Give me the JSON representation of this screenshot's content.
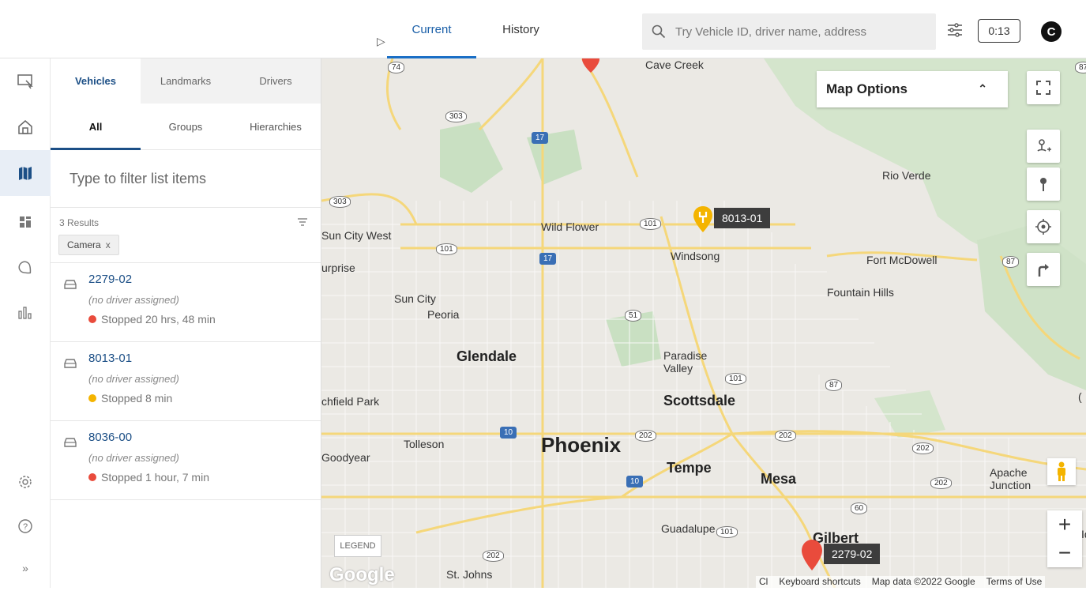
{
  "topbar": {
    "tabs": [
      {
        "label": "Current",
        "active": true
      },
      {
        "label": "History",
        "active": false
      }
    ],
    "search_placeholder": "Try Vehicle ID, driver name, address",
    "timer": "0:13",
    "avatar_initial": "C"
  },
  "leftnav": {
    "items": [
      "live-view-icon",
      "home-icon",
      "map-icon",
      "dashboard-icon",
      "landmark-icon",
      "reports-icon",
      "settings-icon",
      "help-icon",
      "expand-icon"
    ],
    "active": "map-icon",
    "expand_glyph": "»"
  },
  "panel": {
    "entity_tabs": [
      "Vehicles",
      "Landmarks",
      "Drivers"
    ],
    "sub_tabs": [
      "All",
      "Groups",
      "Hierarchies"
    ],
    "filter_placeholder": "Type to filter list items",
    "results_count": "3 Results",
    "chip_label": "Camera",
    "chip_close": "x",
    "vehicles": [
      {
        "id": "2279-02",
        "driver": "(no driver assigned)",
        "status": "Stopped 20 hrs, 48 min",
        "status_color": "#e94b3c"
      },
      {
        "id": "8013-01",
        "driver": "(no driver assigned)",
        "status": "Stopped 8 min",
        "status_color": "#f4b400"
      },
      {
        "id": "8036-00",
        "driver": "(no driver assigned)",
        "status": "Stopped 1 hour, 7 min",
        "status_color": "#e94b3c"
      }
    ]
  },
  "map": {
    "options_label": "Map Options",
    "legend_label": "LEGEND",
    "google_logo": "Google",
    "attribution": [
      "Keyboard shortcuts",
      "Map data ©2022 Google",
      "Terms of Use"
    ],
    "attribution_cut": "Cl",
    "vehicle_labels": {
      "v1": "8013-01",
      "v2": "2279-02"
    },
    "places": {
      "cave_creek": "Cave Creek",
      "rio_verde": "Rio Verde",
      "wild_flower": "Wild Flower",
      "windsong": "Windsong",
      "sun_city_west": "Sun City West",
      "surprise": "urprise",
      "fort_mcdowell": "Fort McDowell",
      "fountain_hills": "Fountain Hills",
      "sun_city": "Sun City",
      "peoria": "Peoria",
      "glendale": "Glendale",
      "paradise_valley": "Paradise\nValley",
      "litchfield_park": "chfield Park",
      "scottsdale": "Scottsdale",
      "tolleson": "Tolleson",
      "phoenix": "Phoenix",
      "goodyear": "Goodyear",
      "tempe": "Tempe",
      "mesa": "Mesa",
      "apache_junction": "Apache\nJunction",
      "guadalupe": "Guadalupe",
      "gilbert": "Gilbert",
      "st_johns": "St. Johns",
      "edge_l": "Id",
      "edge_r": "("
    },
    "shields": {
      "s74": "74",
      "s87a": "87",
      "s303a": "303",
      "s303b": "303",
      "s101a": "101",
      "s101b": "101",
      "s87b": "87",
      "s51": "51",
      "s101c": "101",
      "s87c": "87",
      "s202a": "202",
      "s202b": "202",
      "s202c": "202",
      "s202d": "202",
      "s60": "60",
      "s101d": "101",
      "s202e": "202",
      "i17a": "17",
      "i17b": "17",
      "i10a": "10",
      "i10b": "10"
    },
    "colors": {
      "water_green": "#cfe6c6",
      "road": "#f5d77a",
      "accent": "#1a6fc6"
    }
  }
}
